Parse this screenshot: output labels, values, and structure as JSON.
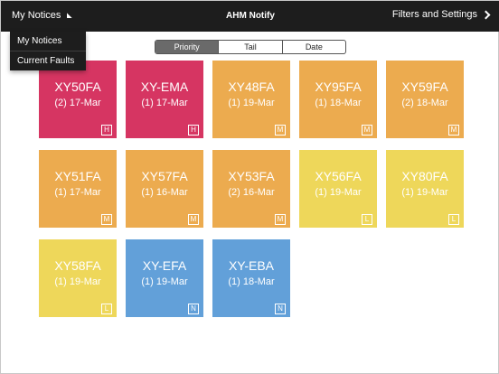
{
  "navbar": {
    "left_label": "My Notices",
    "title": "AHM Notify",
    "right_label": "Filters and Settings"
  },
  "dropdown": {
    "items": [
      {
        "label": "My Notices"
      },
      {
        "label": "Current Faults"
      }
    ]
  },
  "sort_tabs": [
    {
      "label": "Priority",
      "selected": true
    },
    {
      "label": "Tail",
      "selected": false
    },
    {
      "label": "Date",
      "selected": false
    }
  ],
  "colors": {
    "H": "#d63562",
    "M": "#ecab4f",
    "L": "#eed75a",
    "N": "#62a0d9"
  },
  "tiles": [
    {
      "code": "XY50FA",
      "date": "(2) 17-Mar",
      "priority": "H"
    },
    {
      "code": "XY-EMA",
      "date": "(1) 17-Mar",
      "priority": "H"
    },
    {
      "code": "XY48FA",
      "date": "(1) 19-Mar",
      "priority": "M"
    },
    {
      "code": "XY95FA",
      "date": "(1) 18-Mar",
      "priority": "M"
    },
    {
      "code": "XY59FA",
      "date": "(2) 18-Mar",
      "priority": "M"
    },
    {
      "code": "XY51FA",
      "date": "(1) 17-Mar",
      "priority": "M"
    },
    {
      "code": "XY57FA",
      "date": "(1) 16-Mar",
      "priority": "M"
    },
    {
      "code": "XY53FA",
      "date": "(2) 16-Mar",
      "priority": "M"
    },
    {
      "code": "XY56FA",
      "date": "(1) 19-Mar",
      "priority": "L"
    },
    {
      "code": "XY80FA",
      "date": "(1) 19-Mar",
      "priority": "L"
    },
    {
      "code": "XY58FA",
      "date": "(1) 19-Mar",
      "priority": "L"
    },
    {
      "code": "XY-EFA",
      "date": "(1) 19-Mar",
      "priority": "N"
    },
    {
      "code": "XY-EBA",
      "date": "(1) 18-Mar",
      "priority": "N"
    }
  ]
}
